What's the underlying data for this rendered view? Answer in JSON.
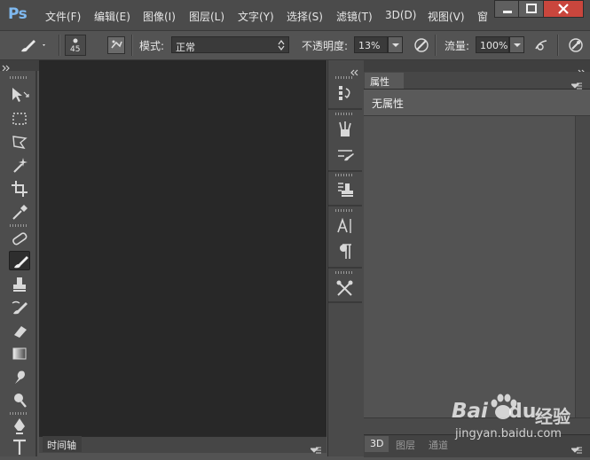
{
  "app": {
    "logo": "Ps",
    "menus": [
      "文件(F)",
      "编辑(E)",
      "图像(I)",
      "图层(L)",
      "文字(Y)",
      "选择(S)",
      "滤镜(T)",
      "3D(D)",
      "视图(V)",
      "窗"
    ]
  },
  "options": {
    "brush_size": "45",
    "mode_label": "模式:",
    "mode_value": "正常",
    "opacity_label": "不透明度:",
    "opacity_value": "13%",
    "flow_label": "流量:",
    "flow_value": "100%"
  },
  "canvas": {
    "timeline_tab": "时间轴"
  },
  "properties": {
    "tab": "属性",
    "empty_text": "无属性"
  },
  "bottom_tabs": [
    "3D",
    "图层",
    "通道"
  ],
  "watermark": {
    "brand_left": "Bai",
    "brand_right": "du",
    "suffix": "经验",
    "url": "jingyan.baidu.com"
  },
  "colors": {
    "logo": "#7fb9f0",
    "canvas": "#282828",
    "panel": "#535353",
    "close_button": "#c9463d"
  }
}
